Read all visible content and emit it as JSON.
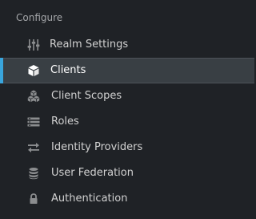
{
  "section": {
    "title": "Configure"
  },
  "nav": {
    "items": [
      {
        "label": "Realm Settings",
        "icon": "sliders-icon",
        "active": false
      },
      {
        "label": "Clients",
        "icon": "cube-icon",
        "active": true
      },
      {
        "label": "Client Scopes",
        "icon": "cubes-icon",
        "active": false
      },
      {
        "label": "Roles",
        "icon": "roles-list-icon",
        "active": false
      },
      {
        "label": "Identity Providers",
        "icon": "exchange-icon",
        "active": false
      },
      {
        "label": "User Federation",
        "icon": "database-icon",
        "active": false
      },
      {
        "label": "Authentication",
        "icon": "lock-icon",
        "active": false
      }
    ]
  },
  "colors": {
    "background": "#1f2226",
    "active_background": "#393f44",
    "active_accent": "#39a5dc",
    "text": "#d1d1d1",
    "active_text": "#ffffff",
    "section_title": "#a3a5a8",
    "icon": "#8b8d8f"
  }
}
